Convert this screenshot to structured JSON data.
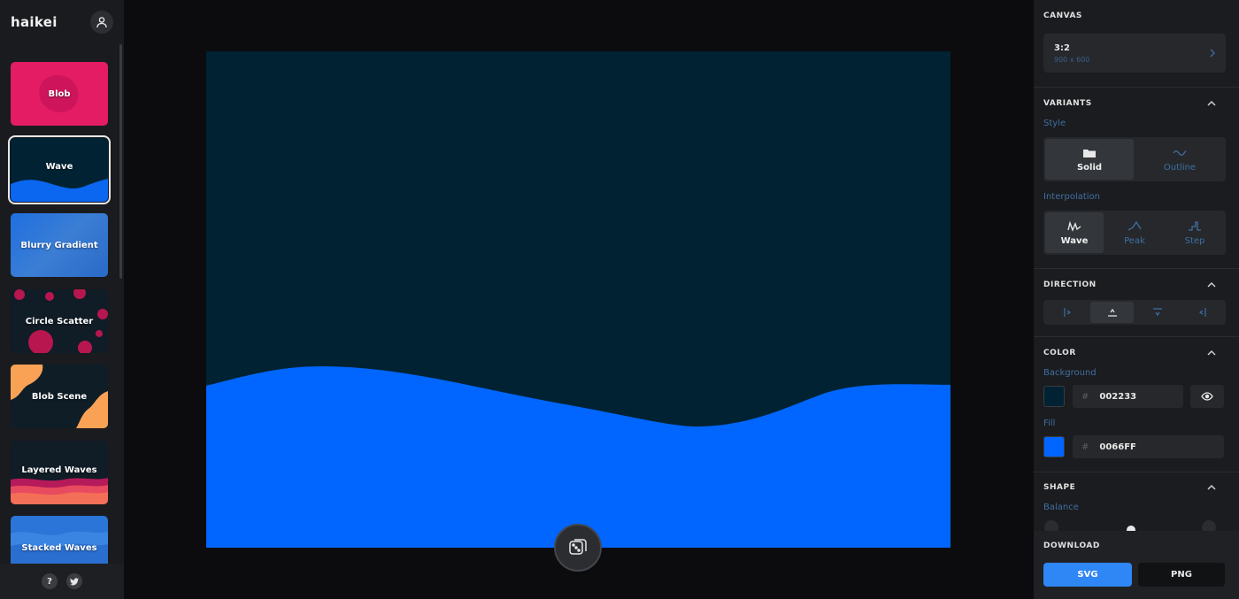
{
  "app": {
    "logo": "haikei"
  },
  "sidebar": {
    "generators": [
      {
        "label": "Blob"
      },
      {
        "label": "Wave"
      },
      {
        "label": "Blurry Gradient"
      },
      {
        "label": "Circle Scatter"
      },
      {
        "label": "Blob Scene"
      },
      {
        "label": "Layered Waves"
      },
      {
        "label": "Stacked Waves"
      }
    ],
    "active": "Wave",
    "help_label": "?"
  },
  "canvas": {
    "background_color": "#002233",
    "fill_color": "#0066FF"
  },
  "panel": {
    "canvas_section": {
      "title": "CANVAS",
      "ratio": "3:2",
      "ratio_sub": "900 x 600"
    },
    "variants": {
      "title": "VARIANTS",
      "style_label": "Style",
      "styles": [
        {
          "label": "Solid",
          "selected": true
        },
        {
          "label": "Outline",
          "selected": false
        }
      ],
      "interpolation_label": "Interpolation",
      "interpolations": [
        {
          "label": "Wave",
          "selected": true
        },
        {
          "label": "Peak",
          "selected": false
        },
        {
          "label": "Step",
          "selected": false
        }
      ]
    },
    "direction": {
      "title": "DIRECTION",
      "selected": "up"
    },
    "color": {
      "title": "COLOR",
      "background_label": "Background",
      "background_hash": "#",
      "background_value": "002233",
      "fill_label": "Fill",
      "fill_hash": "#",
      "fill_value": "0066FF"
    },
    "shape": {
      "title": "SHAPE",
      "balance_label": "Balance"
    },
    "download": {
      "title": "DOWNLOAD",
      "svg_label": "SVG",
      "png_label": "PNG"
    }
  },
  "colors": {
    "accent": "#2f86f5",
    "blob_thumb": "#e31c63",
    "layered_bottom": "#e84a5f",
    "blob_scene_orange": "#f9a255"
  }
}
